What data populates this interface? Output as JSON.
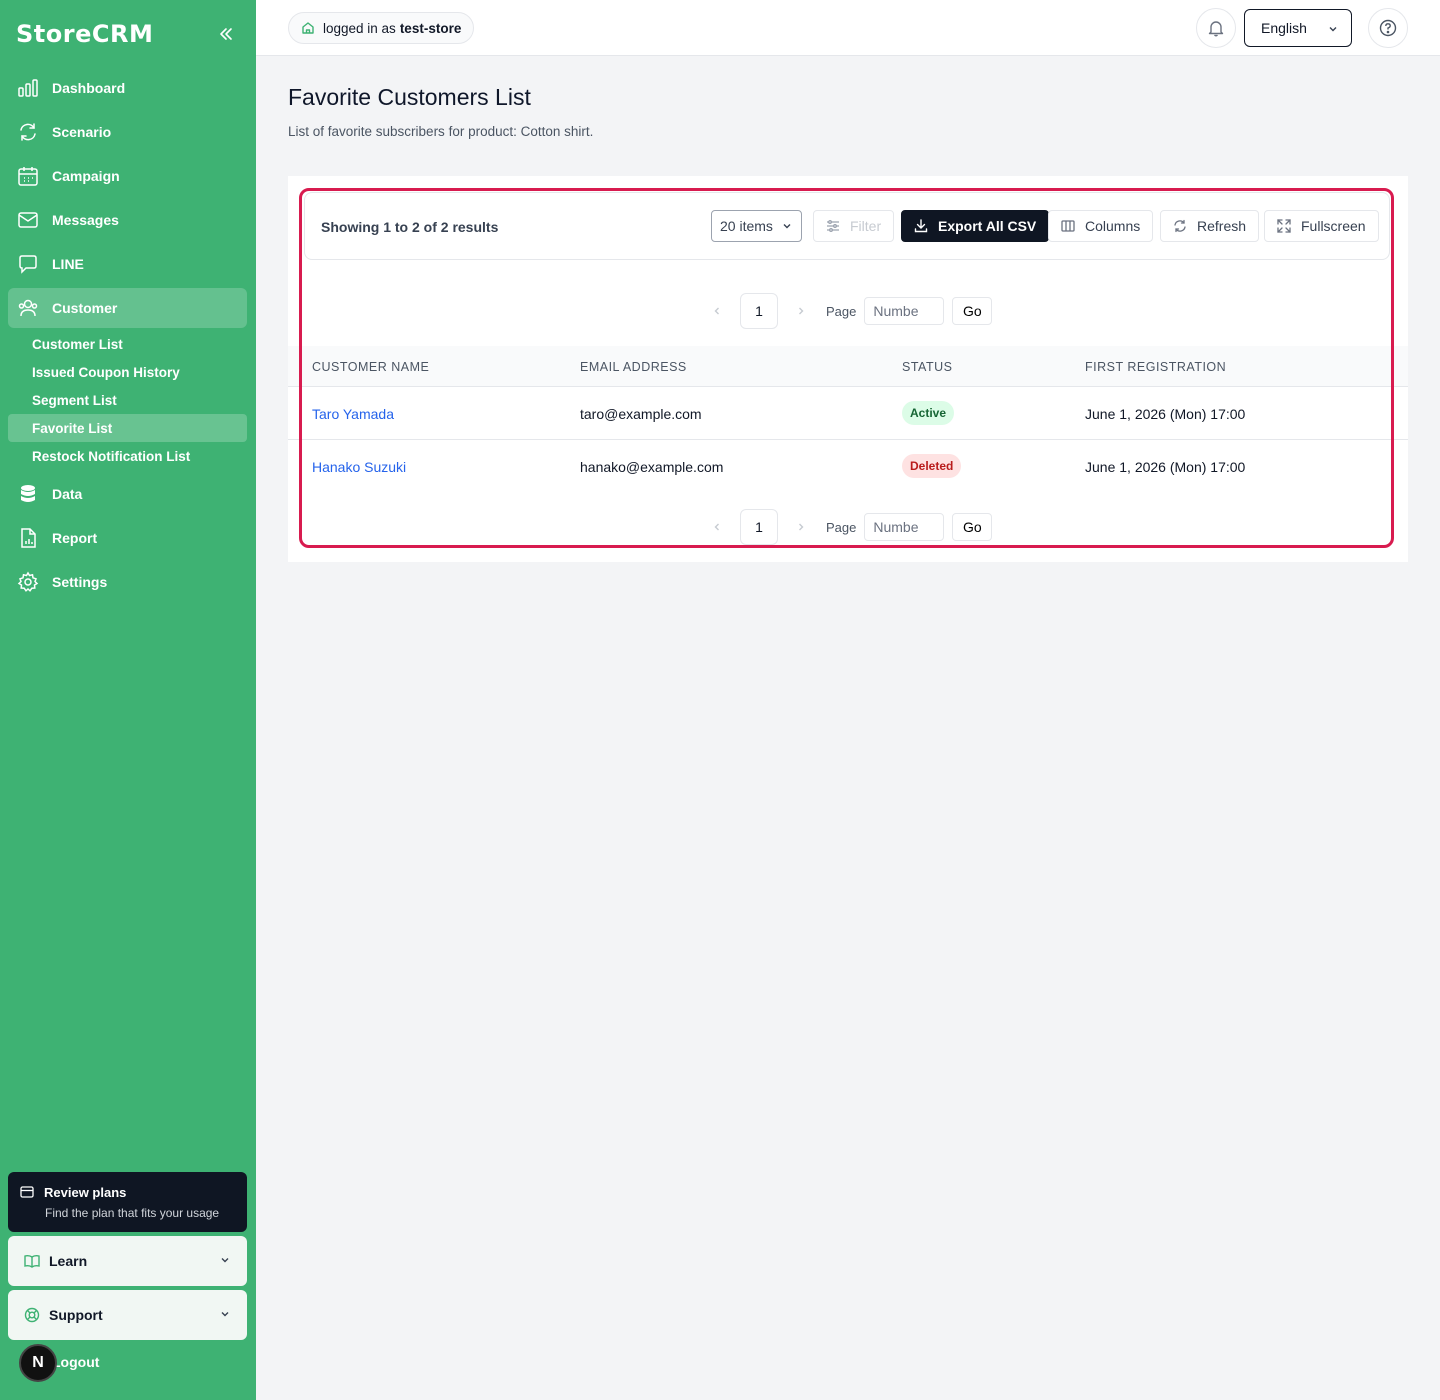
{
  "app": {
    "brand": "StoreCRM"
  },
  "sidebar": {
    "items": [
      {
        "label": "Dashboard",
        "icon": "bar-chart-icon"
      },
      {
        "label": "Scenario",
        "icon": "refresh-cycle-icon"
      },
      {
        "label": "Campaign",
        "icon": "calendar-icon"
      },
      {
        "label": "Messages",
        "icon": "mail-icon"
      },
      {
        "label": "LINE",
        "icon": "chat-bubble-icon"
      },
      {
        "label": "Customer",
        "icon": "users-icon"
      },
      {
        "label": "Data",
        "icon": "database-icon"
      },
      {
        "label": "Report",
        "icon": "report-file-icon"
      },
      {
        "label": "Settings",
        "icon": "gear-icon"
      }
    ],
    "customer_sub": [
      "Customer List",
      "Issued Coupon History",
      "Segment List",
      "Favorite List",
      "Restock Notification List"
    ],
    "review": {
      "title": "Review plans",
      "subtitle": "Find the plan that fits your usage"
    },
    "learn": "Learn",
    "support": "Support",
    "logout": "Logout",
    "avatar_letter": "N"
  },
  "topbar": {
    "login_prefix": "logged in as",
    "login_user": "test-store",
    "language": "English"
  },
  "page": {
    "title": "Favorite Customers List",
    "subtitle": "List of favorite subscribers for product: Cotton shirt."
  },
  "toolbar": {
    "results": "Showing 1 to 2 of 2 results",
    "items_per_page": "20 items",
    "filter": "Filter",
    "export": "Export All CSV",
    "columns": "Columns",
    "refresh": "Refresh",
    "fullscreen": "Fullscreen"
  },
  "pagination": {
    "current_page": "1",
    "page_label": "Page",
    "input_placeholder": "Numbe",
    "go": "Go"
  },
  "table": {
    "headers": [
      "CUSTOMER NAME",
      "EMAIL ADDRESS",
      "STATUS",
      "FIRST REGISTRATION"
    ],
    "rows": [
      {
        "name": "Taro Yamada",
        "email": "taro@example.com",
        "status": "Active",
        "registered": "June 1, 2026 (Mon) 17:00"
      },
      {
        "name": "Hanako Suzuki",
        "email": "hanako@example.com",
        "status": "Deleted",
        "registered": "June 1, 2026 (Mon) 17:00"
      }
    ]
  },
  "colors": {
    "sidebar_bg": "#3eb273",
    "highlight": "#d81b4f",
    "link": "#2563eb",
    "dark_button": "#0f1623"
  }
}
